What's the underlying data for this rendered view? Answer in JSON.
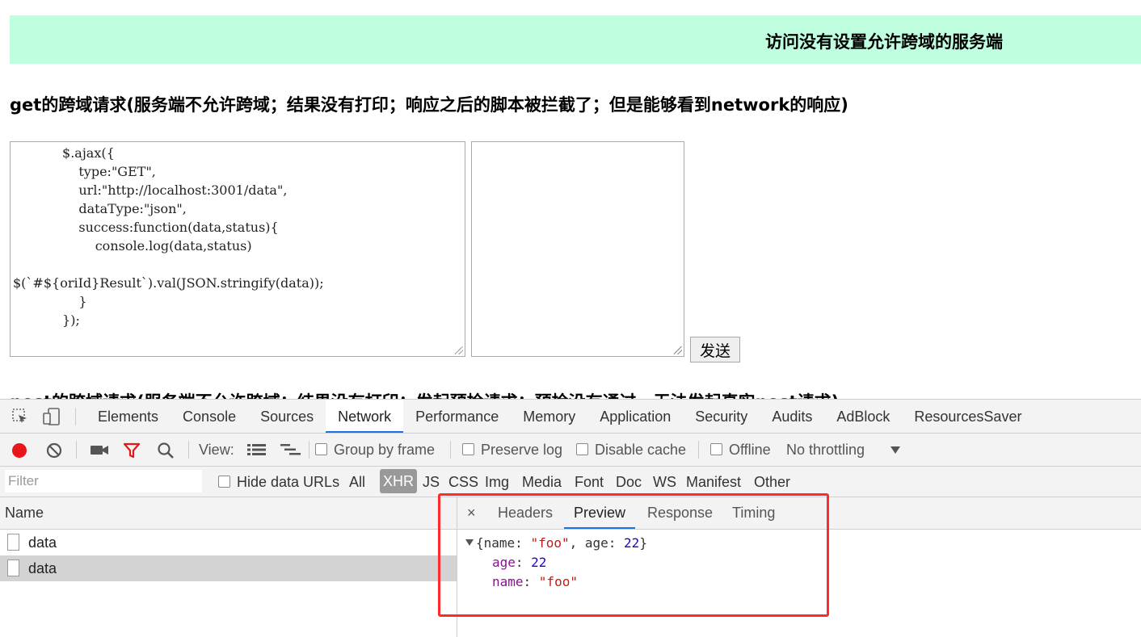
{
  "banner": {
    "text": "访问没有设置允许跨域的服务端"
  },
  "sections": {
    "get_heading": "get的跨域请求(服务端不允许跨域；结果没有打印；响应之后的脚本被拦截了；但是能够看到network的响应)",
    "post_heading": "post的跨域请求(服务端不允许跨域；结果没有打印；发起预检请求；预检没有通过，无法发起真实post请求)"
  },
  "code_box": {
    "text": "            $.ajax({\n                type:\"GET\",\n                url:\"http://localhost:3001/data\",\n                dataType:\"json\",\n                success:function(data,status){\n                    console.log(data,status)\n\n$(`#${oriId}Result`).val(JSON.stringify(data));\n                }\n            });"
  },
  "send_button": "发送",
  "devtools": {
    "tabs": [
      "Elements",
      "Console",
      "Sources",
      "Network",
      "Performance",
      "Memory",
      "Application",
      "Security",
      "Audits",
      "AdBlock",
      "ResourcesSaver"
    ],
    "active_tab": "Network",
    "toolbar": {
      "view_label": "View:",
      "group_by_frame": "Group by frame",
      "preserve_log": "Preserve log",
      "disable_cache": "Disable cache",
      "offline": "Offline",
      "throttling": "No throttling"
    },
    "filter": {
      "placeholder": "Filter",
      "hide_data_urls": "Hide data URLs",
      "types": [
        "All",
        "XHR",
        "JS",
        "CSS",
        "Img",
        "Media",
        "Font",
        "Doc",
        "WS",
        "Manifest",
        "Other"
      ],
      "selected_type": "XHR"
    },
    "requests": {
      "header": "Name",
      "rows": [
        "data",
        "data"
      ]
    },
    "detail": {
      "close": "×",
      "tabs": [
        "Headers",
        "Preview",
        "Response",
        "Timing"
      ],
      "active_tab": "Preview",
      "preview": {
        "summary_open": "{name: ",
        "summary_name": "\"foo\"",
        "summary_mid": ", age: ",
        "summary_age": "22",
        "summary_close": "}",
        "age_key": "age",
        "age_value": "22",
        "name_key": "name",
        "name_value": "\"foo\""
      }
    }
  },
  "colors": {
    "banner_bg": "#bfffdf",
    "highlight_border": "#ff2a2a",
    "record_red": "#e8161b",
    "active_tab_underline": "#1a73e8"
  }
}
